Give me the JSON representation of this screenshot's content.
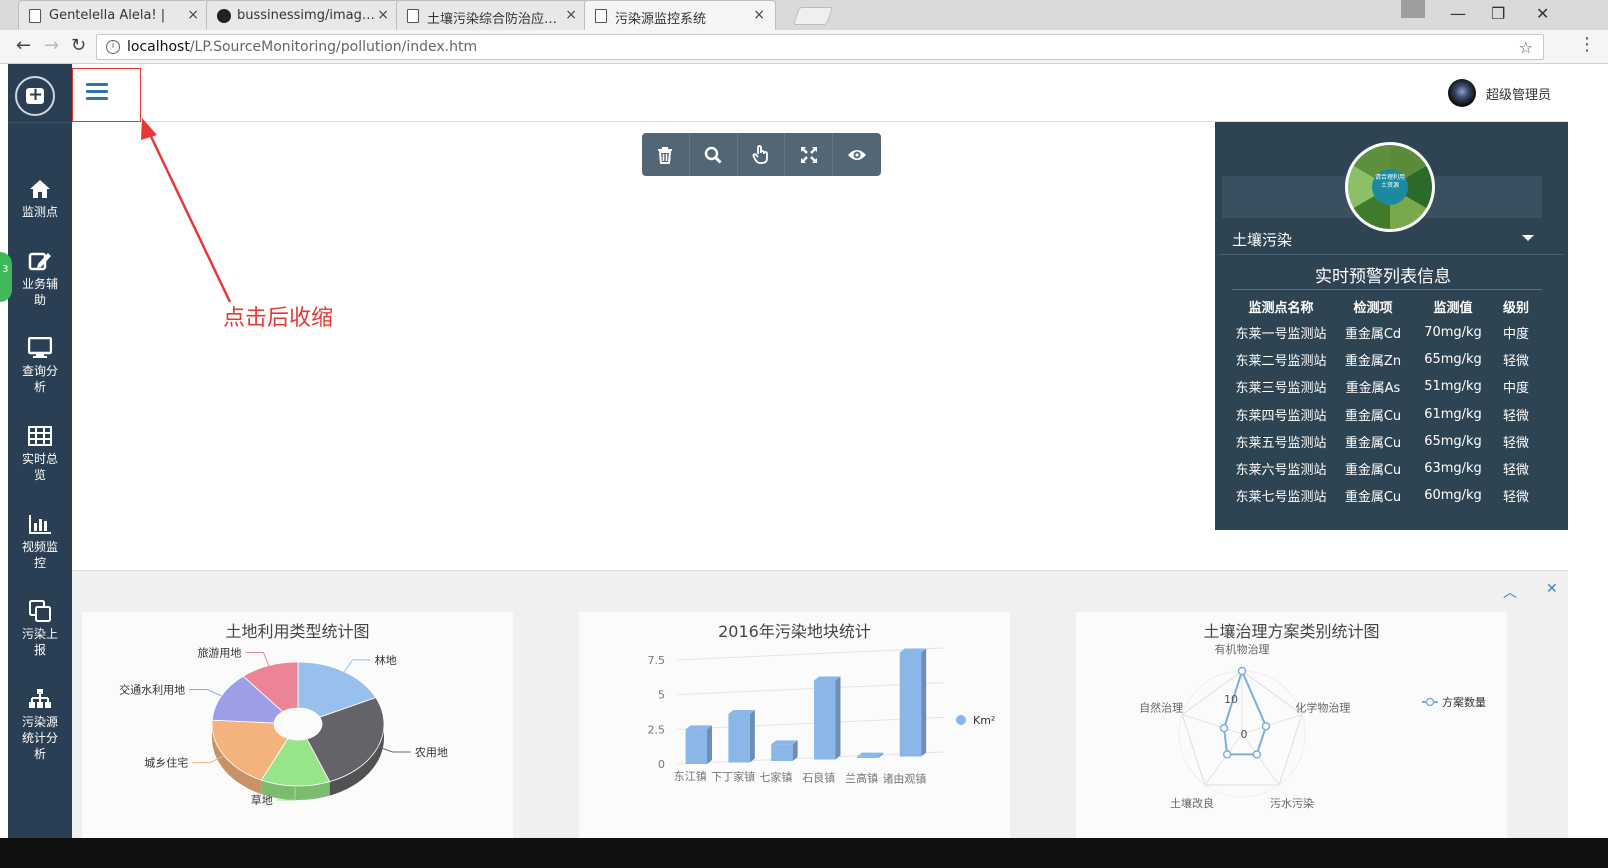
{
  "browser": {
    "tabs": [
      {
        "title": "Gentelella Alela! |",
        "close": "×",
        "icon": "page-icon"
      },
      {
        "title": "bussinessimg/image at",
        "close": "×",
        "icon": "github-icon"
      },
      {
        "title": "土壤污染综合防治应用系",
        "close": "×",
        "icon": "page-icon"
      },
      {
        "title": "污染源监控系统",
        "close": "×",
        "icon": "page-icon"
      }
    ],
    "url_host": "localhost",
    "url_path": "/LP.SourceMonitoring/pollution/index.htm",
    "win_minimize": "—",
    "win_restore": "❐",
    "win_close": "✕",
    "back": "←",
    "forward": "→",
    "reload": "↻",
    "star": "☆",
    "menu": "⋮"
  },
  "sidebar": {
    "side_badge": "3",
    "items": [
      {
        "label": "监测点",
        "icon": "home-icon"
      },
      {
        "label": "业务辅助",
        "icon": "edit-icon"
      },
      {
        "label": "查询分析",
        "icon": "desktop-icon"
      },
      {
        "label": "实时总览",
        "icon": "table-icon"
      },
      {
        "label": "视频监控",
        "icon": "bar-chart-icon"
      },
      {
        "label": "污染上报",
        "icon": "clone-icon"
      },
      {
        "label": "污染源统计分析",
        "icon": "sitemap-icon"
      }
    ]
  },
  "header": {
    "user_name": "超级管理员"
  },
  "annotation": "点击后收缩",
  "toolbar": [
    "trash-icon",
    "search-icon",
    "hand-pointer-icon",
    "expand-icon",
    "eye-icon"
  ],
  "right_panel": {
    "avatar_text": "请合理利用土资源",
    "select_value": "土壤污染",
    "title": "实时预警列表信息",
    "columns": [
      "监测点名称",
      "检测项",
      "监测值",
      "级别"
    ],
    "rows": [
      [
        "东莱一号监测站",
        "重金属Cd",
        "70mg/kg",
        "中度"
      ],
      [
        "东莱二号监测站",
        "重金属Zn",
        "65mg/kg",
        "轻微"
      ],
      [
        "东莱三号监测站",
        "重金属As",
        "51mg/kg",
        "中度"
      ],
      [
        "东莱四号监测站",
        "重金属Cu",
        "61mg/kg",
        "轻微"
      ],
      [
        "东莱五号监测站",
        "重金属Cu",
        "65mg/kg",
        "轻微"
      ],
      [
        "东莱六号监测站",
        "重金属Cu",
        "63mg/kg",
        "轻微"
      ],
      [
        "东莱七号监测站",
        "重金属Cu",
        "60mg/kg",
        "轻微"
      ]
    ]
  },
  "bottom_controls": {
    "collapse": "︿",
    "close": "✕"
  },
  "chart_data": [
    {
      "type": "pie",
      "title": "土地利用类型统计图",
      "labels": [
        "林地",
        "农用地",
        "草地",
        "城乡住宅",
        "交通水利用地",
        "旅游用地"
      ],
      "values": [
        18,
        26,
        13,
        19,
        13,
        11
      ],
      "colors": [
        "#98c0ec",
        "#646468",
        "#98e48a",
        "#f4b27c",
        "#9c9ee8",
        "#ec8498"
      ]
    },
    {
      "type": "bar",
      "title": "2016年污染地块统计",
      "categories": [
        "东江镇",
        "下丁家镇",
        "七家镇",
        "石良镇",
        "兰高镇",
        "诸由观镇"
      ],
      "series": [
        {
          "name": "Km²",
          "values": [
            2.5,
            3.5,
            1.2,
            5.7,
            0.1,
            7.5
          ]
        }
      ],
      "yticks": [
        "0",
        "2.5",
        "5",
        "7.5"
      ],
      "ylim": [
        0,
        7.5
      ],
      "legend": "right",
      "color": "#8ab6e8"
    },
    {
      "type": "radar",
      "title": "土壤治理方案类别统计图",
      "indicators": [
        "有机物治理",
        "化学物治理",
        "污水污染",
        "土壤改良",
        "自然治理"
      ],
      "series": [
        {
          "name": "方案数量",
          "values": [
            10,
            4,
            4,
            4,
            3
          ]
        }
      ],
      "ticks": [
        "10",
        "0"
      ],
      "max": 10,
      "legend": "right",
      "color": "#7aaee0"
    }
  ]
}
